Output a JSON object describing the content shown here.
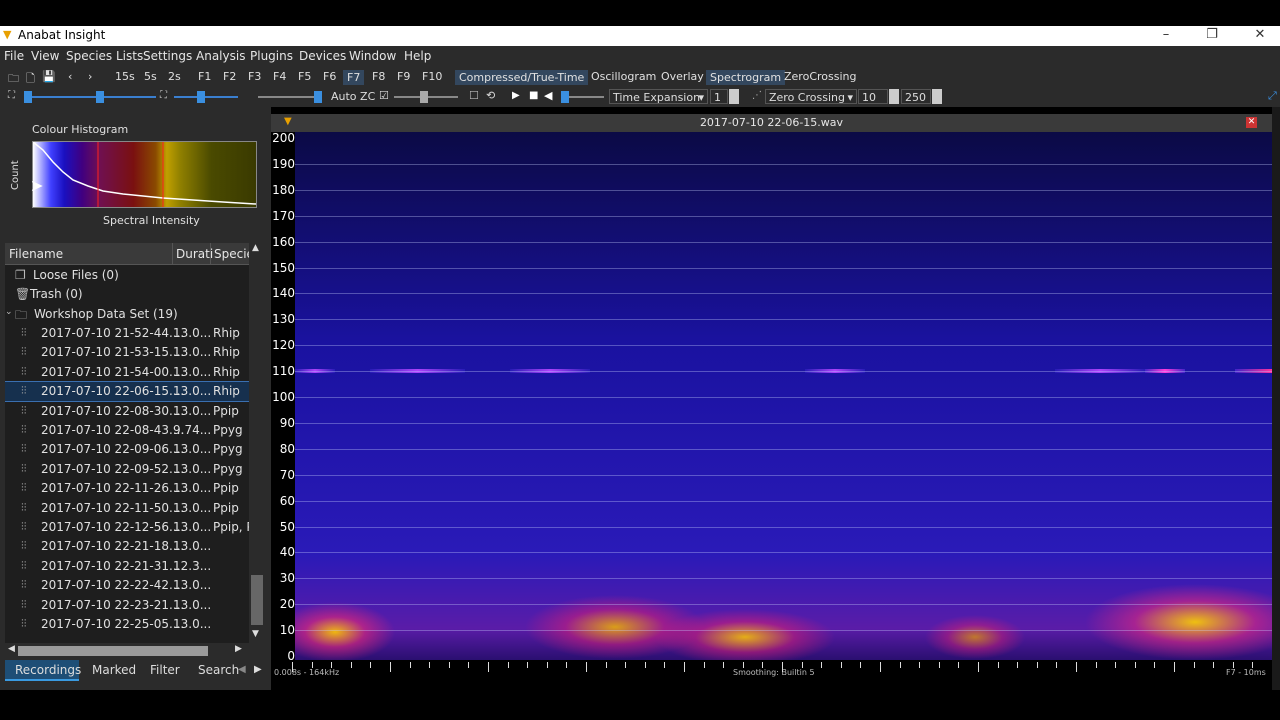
{
  "window": {
    "title": "Anabat Insight",
    "controls": [
      "–",
      "❐",
      "✕"
    ]
  },
  "menu": [
    "File",
    "View",
    "Species Lists",
    "Settings",
    "Analysis",
    "Plugins",
    "Devices",
    "Window",
    "Help"
  ],
  "toolbar1": {
    "durations": [
      "15s",
      "5s",
      "2s"
    ],
    "fkeys": [
      "F1",
      "F2",
      "F3",
      "F4",
      "F5",
      "F6",
      "F7",
      "F8",
      "F9",
      "F10"
    ],
    "views": [
      "Compressed/True-Time",
      "Oscillogram",
      "Overlay",
      "Spectrogram",
      "ZeroCrossing"
    ]
  },
  "toolbar2": {
    "auto_zc": "Auto ZC",
    "mode": "Time Expansion",
    "factor": "1",
    "zc_mode": "Zero Crossing",
    "zc_min": "10",
    "zc_max": "250"
  },
  "histogram": {
    "title": "Colour Histogram",
    "ylabel": "Count",
    "xlabel": "Spectral Intensity"
  },
  "tree": {
    "columns": [
      "Filename",
      "Durati",
      "Specie"
    ],
    "loose": "Loose Files (0)",
    "trash": "Trash (0)",
    "dataset": "Workshop Data Set (19)",
    "files": [
      {
        "name": "2017-07-10 21-52-44....",
        "dur": "13.0...",
        "sp": "Rhip"
      },
      {
        "name": "2017-07-10 21-53-15....",
        "dur": "13.0...",
        "sp": "Rhip"
      },
      {
        "name": "2017-07-10 21-54-00....",
        "dur": "13.0...",
        "sp": "Rhip"
      },
      {
        "name": "2017-07-10 22-06-15....",
        "dur": "13.0...",
        "sp": "Rhip"
      },
      {
        "name": "2017-07-10 22-08-30....",
        "dur": "13.0...",
        "sp": "Ppip"
      },
      {
        "name": "2017-07-10 22-08-43....",
        "dur": "9.74...",
        "sp": "Ppyg"
      },
      {
        "name": "2017-07-10 22-09-06....",
        "dur": "13.0...",
        "sp": "Ppyg"
      },
      {
        "name": "2017-07-10 22-09-52....",
        "dur": "13.0...",
        "sp": "Ppyg"
      },
      {
        "name": "2017-07-10 22-11-26....",
        "dur": "13.0...",
        "sp": "Ppip"
      },
      {
        "name": "2017-07-10 22-11-50....",
        "dur": "13.0...",
        "sp": "Ppip"
      },
      {
        "name": "2017-07-10 22-12-56....",
        "dur": "13.0...",
        "sp": "Ppip, P"
      },
      {
        "name": "2017-07-10 22-21-18....",
        "dur": "13.0...",
        "sp": ""
      },
      {
        "name": "2017-07-10 22-21-31....",
        "dur": "12.3...",
        "sp": ""
      },
      {
        "name": "2017-07-10 22-22-42....",
        "dur": "13.0...",
        "sp": ""
      },
      {
        "name": "2017-07-10 22-23-21....",
        "dur": "13.0...",
        "sp": ""
      },
      {
        "name": "2017-07-10 22-25-05....",
        "dur": "13.0...",
        "sp": ""
      }
    ],
    "selected_index": 3
  },
  "bottom_tabs": [
    "Recordings",
    "Marked",
    "Filter",
    "Search"
  ],
  "spectrogram": {
    "file": "2017-07-10 22-06-15.wav",
    "y_ticks": [
      "200",
      "190",
      "180",
      "170",
      "160",
      "150",
      "140",
      "130",
      "120",
      "110",
      "100",
      "90",
      "80",
      "70",
      "60",
      "50",
      "40",
      "30",
      "20",
      "10",
      "0"
    ],
    "x_left_label": "0.008s - 164kHz",
    "x_center_label": "Smoothing: Builtin 5",
    "x_right_label": "F7 - 10ms"
  }
}
